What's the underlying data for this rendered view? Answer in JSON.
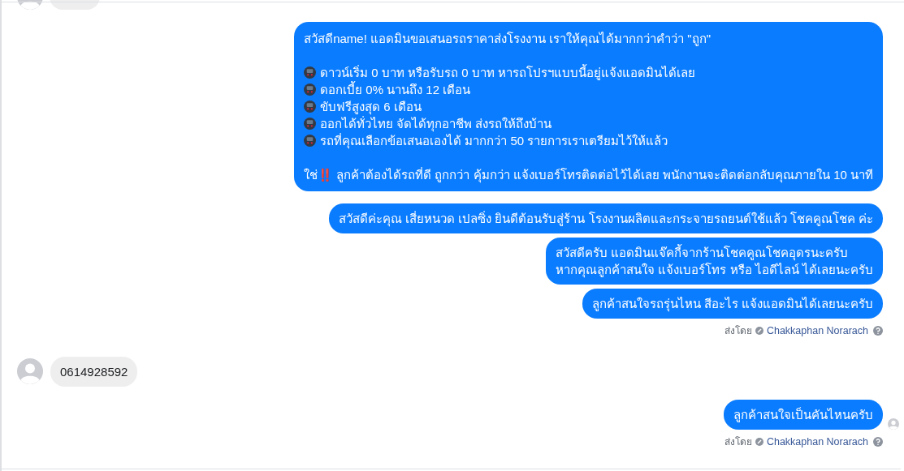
{
  "messages": [
    {
      "outgoing": false,
      "kind": "cut"
    },
    {
      "outgoing": true,
      "kind": "blocks",
      "blocks": [
        {
          "kind": "text",
          "text": "สวัสดีname! แอดมินขอเสนอรถราคาส่งโรงงาน เราให้คุณได้มากกว่าคำว่า \"ถูก\""
        },
        {
          "kind": "bullets",
          "items": [
            "ดาวน์เริ่ม 0 บาท หรือรับรถ 0 บาท หารถโปรฯแบบนี้อยู่แจ้งแอดมินได้เลย",
            "ดอกเบี้ย 0% นานถึง 12 เดือน",
            "ขับฟรีสูงสุด 6 เดือน",
            "ออกได้ทั่วไทย จัดได้ทุกอาชีพ ส่งรถให้ถึงบ้าน",
            "รถที่คุณเลือกข้อเสนอเองได้ มากกว่า 50 รายการเราเตรียมไว้ให้แล้ว"
          ]
        },
        {
          "kind": "text",
          "text": "ใช่‼️ ลูกค้าต้องได้รถที่ดี ถูกกว่า คุ้มกว่า แจ้งเบอร์โทรติดต่อไว้ได้เลย พนักงานจะติดต่อกลับคุณภายใน 10 นาที"
        }
      ]
    },
    {
      "outgoing": true,
      "kind": "lines",
      "lines": [
        "สวัสดีค่ะคุณ เสี่ยหนวด เปลซิ่ง ยินดีต้อนรับสู่ร้าน โรงงานผลิตและกระจายรถยนต์ใช้แล้ว โชคคูณโชค ค่ะ"
      ]
    },
    {
      "outgoing": true,
      "kind": "lines",
      "lines": [
        "สวัสดีครับ แอดมินแจ๊คกี้จากร้านโชคคูณโชคอุดรนะครับ",
        "หากคุณลูกค้าสนใจ แจ้งเบอร์โทร หรือ ไอดีไลน์ ได้เลยนะครับ"
      ]
    },
    {
      "outgoing": true,
      "kind": "lines",
      "lines": [
        "ลูกค้าสนใจรถรุ่นไหน สีอะไร แจ้งแอดมินได้เลยนะครับ"
      ]
    },
    {
      "kind": "sent_by",
      "label": "ส่งโดย",
      "name": "Chakkaphan Norarach"
    },
    {
      "outgoing": false,
      "kind": "lines",
      "lines": [
        "0614928592"
      ]
    },
    {
      "outgoing": true,
      "kind": "lines",
      "seen": true,
      "lines": [
        "ลูกค้าสนใจเป็นคันไหนครับ"
      ]
    },
    {
      "kind": "sent_by",
      "label": "ส่งโดย",
      "name": "Chakkaphan Norarach"
    }
  ]
}
